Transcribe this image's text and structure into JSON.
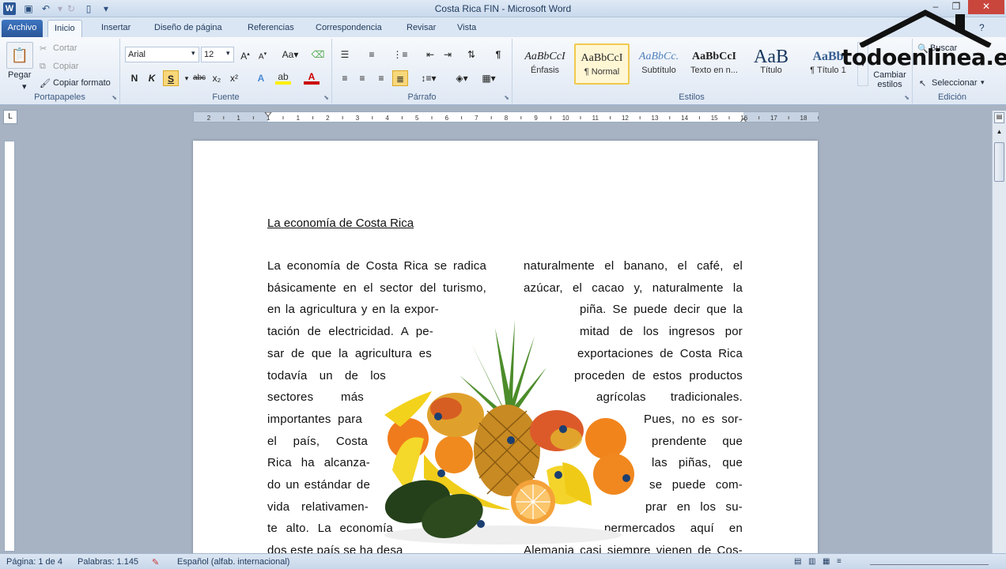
{
  "window": {
    "title": "Costa Rica FIN  -  Microsoft Word"
  },
  "tabs": [
    "Archivo",
    "Inicio",
    "Insertar",
    "Diseño de página",
    "Referencias",
    "Correspondencia",
    "Revisar",
    "Vista"
  ],
  "clipboard": {
    "paste": "Pegar",
    "cut": "Cortar",
    "copy": "Copiar",
    "format_painter": "Copiar formato",
    "label": "Portapapeles"
  },
  "font": {
    "name": "Arial",
    "size": "12",
    "label": "Fuente",
    "bold": "N",
    "italic": "K",
    "underline": "S",
    "strike": "abc",
    "sub": "x₂",
    "sup": "x²"
  },
  "paragraph": {
    "label": "Párrafo"
  },
  "styles": {
    "label": "Estilos",
    "items": [
      {
        "sample": "AaBbCcI",
        "name": "Énfasis"
      },
      {
        "sample": "AaBbCcI",
        "name": "¶ Normal"
      },
      {
        "sample": "AaBbCc.",
        "name": "Subtítulo"
      },
      {
        "sample": "AaBbCcI",
        "name": "Texto en n..."
      },
      {
        "sample": "AaB",
        "name": "Título"
      },
      {
        "sample": "AaBb",
        "name": "¶ Título 1"
      }
    ],
    "change": "Cambiar estilos"
  },
  "editing": {
    "find": "Buscar",
    "select": "Seleccionar",
    "label": "Edición"
  },
  "watermark": {
    "text": "todoenlinea.es"
  },
  "document": {
    "title": "La economía de Costa Rica",
    "left_lines": [
      "La economía de Costa Rica se radica",
      "básicamente en el sector del turismo,",
      "en la agricultura y en la expor-",
      "tación de electricidad. A pe-",
      "sar de que la agricultura es",
      "todavía  un  de  los",
      "sectores      más",
      "importantes para",
      "el   país,   Costa",
      "Rica  ha  alcanza-",
      "do un estándar de",
      "vida  relativamen-",
      "te  alto.  La  economía",
      "dos  este  país  se  ha  desa"
    ],
    "right_lines": [
      "naturalmente el banano, el café, el",
      "azúcar, el cacao y, naturalmente la",
      "piña. Se puede decir que la",
      "mitad  de  los  ingresos  por",
      "exportaciones de Costa Rica",
      "proceden de estos productos",
      "agrícolas    tradicionales.",
      "Pues,  no  es  sor-",
      "prendente   que",
      "las   piñas,   que",
      "se   puede   com-",
      "prar  en  los  su-",
      "permercados   aquí   en",
      "Alemania casi siempre vienen de Cos-"
    ]
  },
  "status": {
    "page": "Página: 1 de 4",
    "words": "Palabras: 1.145",
    "language": "Español (alfab. internacional)"
  },
  "ruler_numbers": [
    "2",
    "1",
    "1",
    "1",
    "2",
    "3",
    "4",
    "5",
    "6",
    "7",
    "8",
    "9",
    "10",
    "11",
    "12",
    "13",
    "14",
    "15",
    "16",
    "17",
    "18"
  ]
}
